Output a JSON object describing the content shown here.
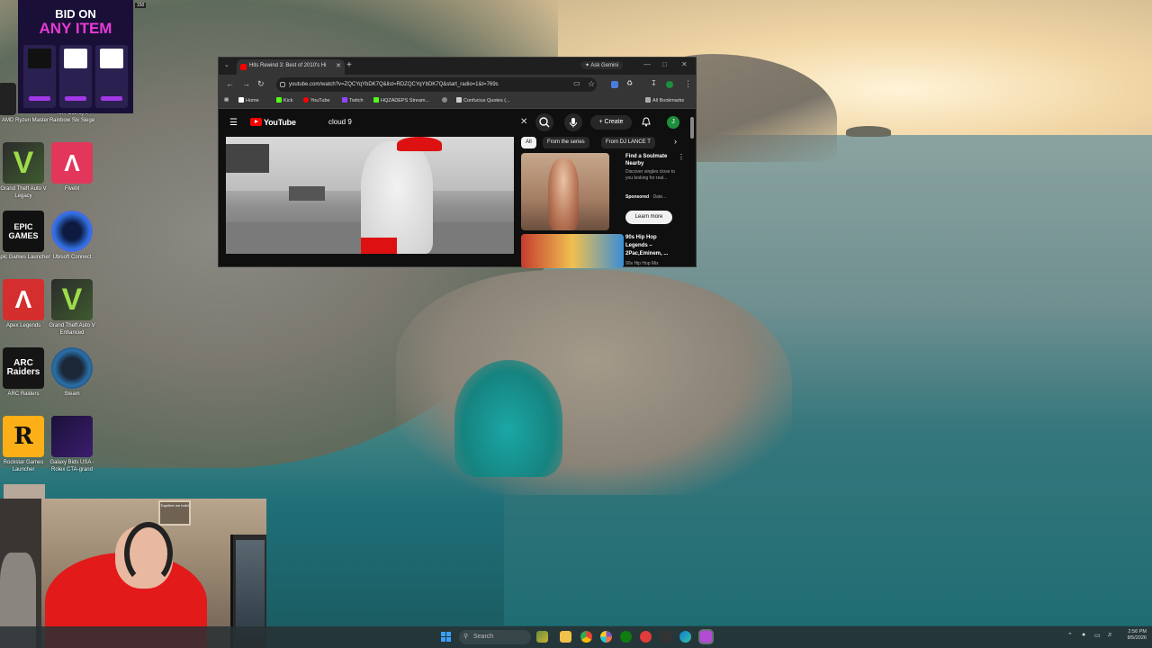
{
  "desktop": {
    "icons": [
      {
        "label": "AMD Ryzen Master"
      },
      {
        "label": "Tom Clancy's Rainbow Six Siege"
      },
      {
        "label": "Grand Theft Auto V Legacy"
      },
      {
        "label": "FiveM"
      },
      {
        "label": "Epic Games Launcher"
      },
      {
        "label": "Ubisoft Connect"
      },
      {
        "label": "Apex Legends"
      },
      {
        "label": "Grand Theft Auto V Enhanced"
      },
      {
        "label": "ARC Raiders"
      },
      {
        "label": "Steam"
      },
      {
        "label": "Rockstar Games Launcher"
      },
      {
        "label": "Galaxy Bids USA - Rolex CTA-grand"
      }
    ],
    "tile_text": {
      "epic": "EPIC GAMES",
      "arc": "ARC Raiders",
      "rockstar": "R"
    },
    "counter": "150"
  },
  "ad": {
    "line1": "BID ON",
    "line2": "ANY ITEM"
  },
  "browser": {
    "tab_title": "Hits Rewind 3: Best of 2010's Hi",
    "ask_gemini": "Ask Gemini",
    "url": "youtube.com/watch?v=ZQCYqYbDK7Q&list=RDZQCYqYbDK7Q&start_radio=1&t=769s",
    "bookmarks": [
      {
        "label": "Home",
        "color": "#ffffff"
      },
      {
        "label": "Kick",
        "color": "#53fc18"
      },
      {
        "label": "YouTube",
        "color": "#ff0000"
      },
      {
        "label": "Twitch",
        "color": "#9146ff"
      },
      {
        "label": "HQZADEPS Stream...",
        "color": "#53fc18"
      },
      {
        "label": "",
        "color": "#888888"
      },
      {
        "label": "Confucius Quotes (...",
        "color": "#cccccc"
      }
    ],
    "all_bookmarks": "All Bookmarks"
  },
  "youtube": {
    "logo": "YouTube",
    "search_value": "cloud 9",
    "create_label": "Create",
    "avatar_initial": "J",
    "chips": [
      "All",
      "From the series",
      "From DJ LANCE T"
    ],
    "suggestions": [
      {
        "title": "Find a Soulmate Nearby",
        "description": "Discover singles close to you looking for real...",
        "sponsored": "Sponsored",
        "advertiser": " · Date...",
        "cta": "Learn more"
      },
      {
        "title": "90s Hip Hop Legends – 2Pac,Eminem, ...",
        "subtitle": "90s Hip Hop Mix"
      }
    ]
  },
  "webcam": {
    "sign_text": "Together we build"
  },
  "taskbar": {
    "search_placeholder": "Search",
    "time": "2:56 PM",
    "date": "8/5/2026"
  }
}
